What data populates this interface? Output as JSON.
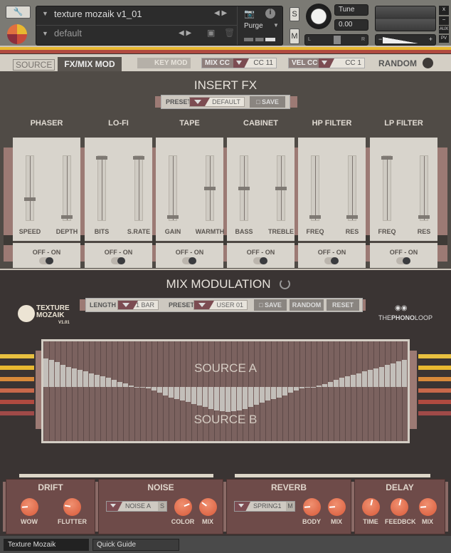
{
  "header": {
    "instrument_name": "texture mozaik v1_01",
    "preset_name": "default",
    "purge_label": "Purge",
    "tune_label": "Tune",
    "tune_value": "0.00",
    "solo_label": "S",
    "mute_label": "M",
    "pan_left": "L",
    "pan_right": "R",
    "vol_minus": "−",
    "vol_plus": "+",
    "aux_label": "AUX",
    "pv_label": "PV",
    "close_label": "x",
    "min_label": "−"
  },
  "tabs": {
    "source": "SOURCE",
    "fxmix": "FX/MIX MOD",
    "keymod": "KEY MOD",
    "mixcc_label": "MIX CC",
    "mixcc_value": "CC 11",
    "velcc_label": "VEL CC",
    "velcc_value": "CC 1",
    "random": "RANDOM"
  },
  "insert_fx": {
    "title": "INSERT FX",
    "preset_label": "PRESET",
    "preset_value": "DEFAULT",
    "save_label": "SAVE",
    "toggle_label": "OFF  -  ON",
    "modules": [
      {
        "name": "PHASER",
        "sliders": [
          {
            "label": "SPEED",
            "value": 0.32
          },
          {
            "label": "DEPTH",
            "value": 0.03
          }
        ],
        "enabled": true
      },
      {
        "name": "LO-FI",
        "sliders": [
          {
            "label": "BITS",
            "value": 1.0
          },
          {
            "label": "S.RATE",
            "value": 1.0
          }
        ],
        "enabled": true
      },
      {
        "name": "TAPE",
        "sliders": [
          {
            "label": "GAIN",
            "value": 0.03
          },
          {
            "label": "WARMTH",
            "value": 0.5
          }
        ],
        "enabled": true
      },
      {
        "name": "CABINET",
        "sliders": [
          {
            "label": "BASS",
            "value": 0.5
          },
          {
            "label": "TREBLE",
            "value": 0.5
          }
        ],
        "enabled": true
      },
      {
        "name": "HP FILTER",
        "sliders": [
          {
            "label": "FREQ",
            "value": 0.03
          },
          {
            "label": "RES",
            "value": 0.03
          }
        ],
        "enabled": true
      },
      {
        "name": "LP FILTER",
        "sliders": [
          {
            "label": "FREQ",
            "value": 1.0
          },
          {
            "label": "RES",
            "value": 0.03
          }
        ],
        "enabled": true
      }
    ]
  },
  "mix_mod": {
    "title": "MIX MODULATION",
    "length_label": "LENGTH",
    "length_value": "1 BAR",
    "preset_label": "PRESET",
    "preset_value": "USER 01",
    "save_label": "SAVE",
    "random_label": "RANDOM",
    "reset_label": "RESET",
    "source_a": "SOURCE A",
    "source_b": "SOURCE B",
    "steps": [
      1.0,
      0.95,
      0.87,
      0.78,
      0.7,
      0.64,
      0.6,
      0.55,
      0.48,
      0.43,
      0.38,
      0.33,
      0.25,
      0.18,
      0.12,
      0.05,
      0,
      0,
      -0.05,
      -0.12,
      -0.2,
      -0.3,
      -0.37,
      -0.43,
      -0.47,
      -0.52,
      -0.6,
      -0.65,
      -0.7,
      -0.78,
      -0.82,
      -0.86,
      -0.88,
      -0.86,
      -0.82,
      -0.78,
      -0.7,
      -0.62,
      -0.55,
      -0.47,
      -0.43,
      -0.37,
      -0.3,
      -0.2,
      -0.12,
      -0.06,
      0,
      0,
      0.05,
      0.1,
      0.17,
      0.25,
      0.33,
      0.38,
      0.43,
      0.48,
      0.55,
      0.6,
      0.65,
      0.7,
      0.78,
      0.82,
      0.9,
      0.95
    ]
  },
  "logo": {
    "line1": "TEXTURE",
    "line2": "MOZAIK",
    "version": "V1.01"
  },
  "brand": {
    "the": "THE",
    "phono": "PHONO",
    "loop": "LOOP"
  },
  "master_fx": {
    "drift": {
      "title": "DRIFT",
      "knobs": [
        {
          "label": "WOW",
          "value": 0.15
        },
        {
          "label": "FLUTTER",
          "value": 0.2
        }
      ]
    },
    "noise": {
      "title": "NOISE",
      "type": "NOISE A",
      "mode": "S",
      "knobs": [
        {
          "label": "COLOR",
          "value": 0.75
        },
        {
          "label": "MIX",
          "value": 0.3
        }
      ]
    },
    "reverb": {
      "title": "REVERB",
      "type": "SPRING1",
      "mode": "M",
      "knobs": [
        {
          "label": "BODY",
          "value": 0.15
        },
        {
          "label": "MIX",
          "value": 0.15
        }
      ]
    },
    "delay": {
      "title": "DELAY",
      "knobs": [
        {
          "label": "TIME",
          "value": 0.55
        },
        {
          "label": "FEEDBCK",
          "value": 0.55
        },
        {
          "label": "MIX",
          "value": 0.15
        }
      ]
    }
  },
  "footer": {
    "tab1": "Texture Mozaik",
    "tab2": "Quick Guide"
  },
  "colors": {
    "accent": "#7c4c52",
    "knob": "#e0704e",
    "stripe_yellow": "#e8b830",
    "stripe_red": "#b04a40"
  }
}
